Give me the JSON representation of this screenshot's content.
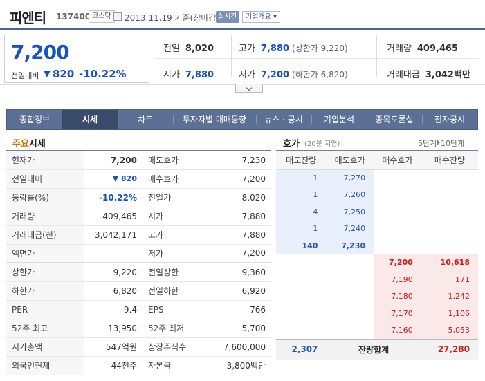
{
  "header": {
    "name": "피엔티",
    "code": "137400",
    "market": "코스닥",
    "date_text": "2013.11.19 기준(장마감)",
    "realtime_btn": "실시간",
    "overview_btn": "기업개요 ▾"
  },
  "summary": {
    "price": "7,200",
    "prev_label": "전일대비",
    "change": "820",
    "change_pct": "-10.22%",
    "prev_close": {
      "label": "전일",
      "value": "8,020"
    },
    "high": {
      "label": "고가",
      "value": "7,880",
      "extra": "(상한가 9,220)"
    },
    "volume": {
      "label": "거래량",
      "value": "409,465"
    },
    "open": {
      "label": "시가",
      "value": "7,880"
    },
    "low": {
      "label": "저가",
      "value": "7,200",
      "extra": "(하한가 6,820)"
    },
    "amount": {
      "label": "거래대금",
      "value": "3,042",
      "unit": "백만"
    }
  },
  "tabs": [
    "종합정보",
    "시세",
    "차트",
    "투자자별 매매동향",
    "뉴스 · 공시",
    "기업분석",
    "종목토론실",
    "전자공시"
  ],
  "quote": {
    "title_accent": "주요",
    "title_rest": "시세",
    "rows": [
      [
        "현재가",
        "7,200",
        "매도호가",
        "7,230"
      ],
      [
        "전일대비",
        "▼ 820",
        "매수호가",
        "7,200"
      ],
      [
        "등락률(%)",
        "-10.22%",
        "전일가",
        "8,020"
      ],
      [
        "거래량",
        "409,465",
        "시가",
        "7,880"
      ],
      [
        "거래대금(천)",
        "3,042,171",
        "고가",
        "7,880"
      ],
      [
        "액면가",
        "",
        "저가",
        "7,200"
      ],
      [
        "상한가",
        "9,220",
        "전일상한",
        "9,360"
      ],
      [
        "하한가",
        "6,820",
        "전일하한",
        "6,920"
      ],
      [
        "PER",
        "9.4",
        "EPS",
        "766"
      ],
      [
        "52주 최고",
        "13,950",
        "52주 최저",
        "5,700"
      ],
      [
        "시가총액",
        "547억원",
        "상장주식수",
        "7,600,000"
      ],
      [
        "외국인현재",
        "44천주",
        "자본금",
        "3,800백만"
      ]
    ]
  },
  "orderbook": {
    "title": "호가",
    "subtitle": "(20분 지연)",
    "step_selected": "5단계",
    "step_other": "10단계",
    "headers": [
      "매도잔량",
      "매도호가",
      "매수호가",
      "매수잔량"
    ],
    "asks": [
      [
        "1",
        "7,270"
      ],
      [
        "1",
        "7,260"
      ],
      [
        "4",
        "7,250"
      ],
      [
        "1",
        "7,240"
      ],
      [
        "140",
        "7,230"
      ]
    ],
    "bids": [
      [
        "7,200",
        "10,618"
      ],
      [
        "7,190",
        "171"
      ],
      [
        "7,180",
        "1,242"
      ],
      [
        "7,170",
        "1,106"
      ],
      [
        "7,160",
        "5,053"
      ]
    ],
    "total_label": "잔량합계",
    "total_ask": "2,307",
    "total_bid": "27,280"
  },
  "colors": {
    "down": "#1a52c4",
    "up": "#d01a1a",
    "tabbar": "#5c6f94"
  }
}
